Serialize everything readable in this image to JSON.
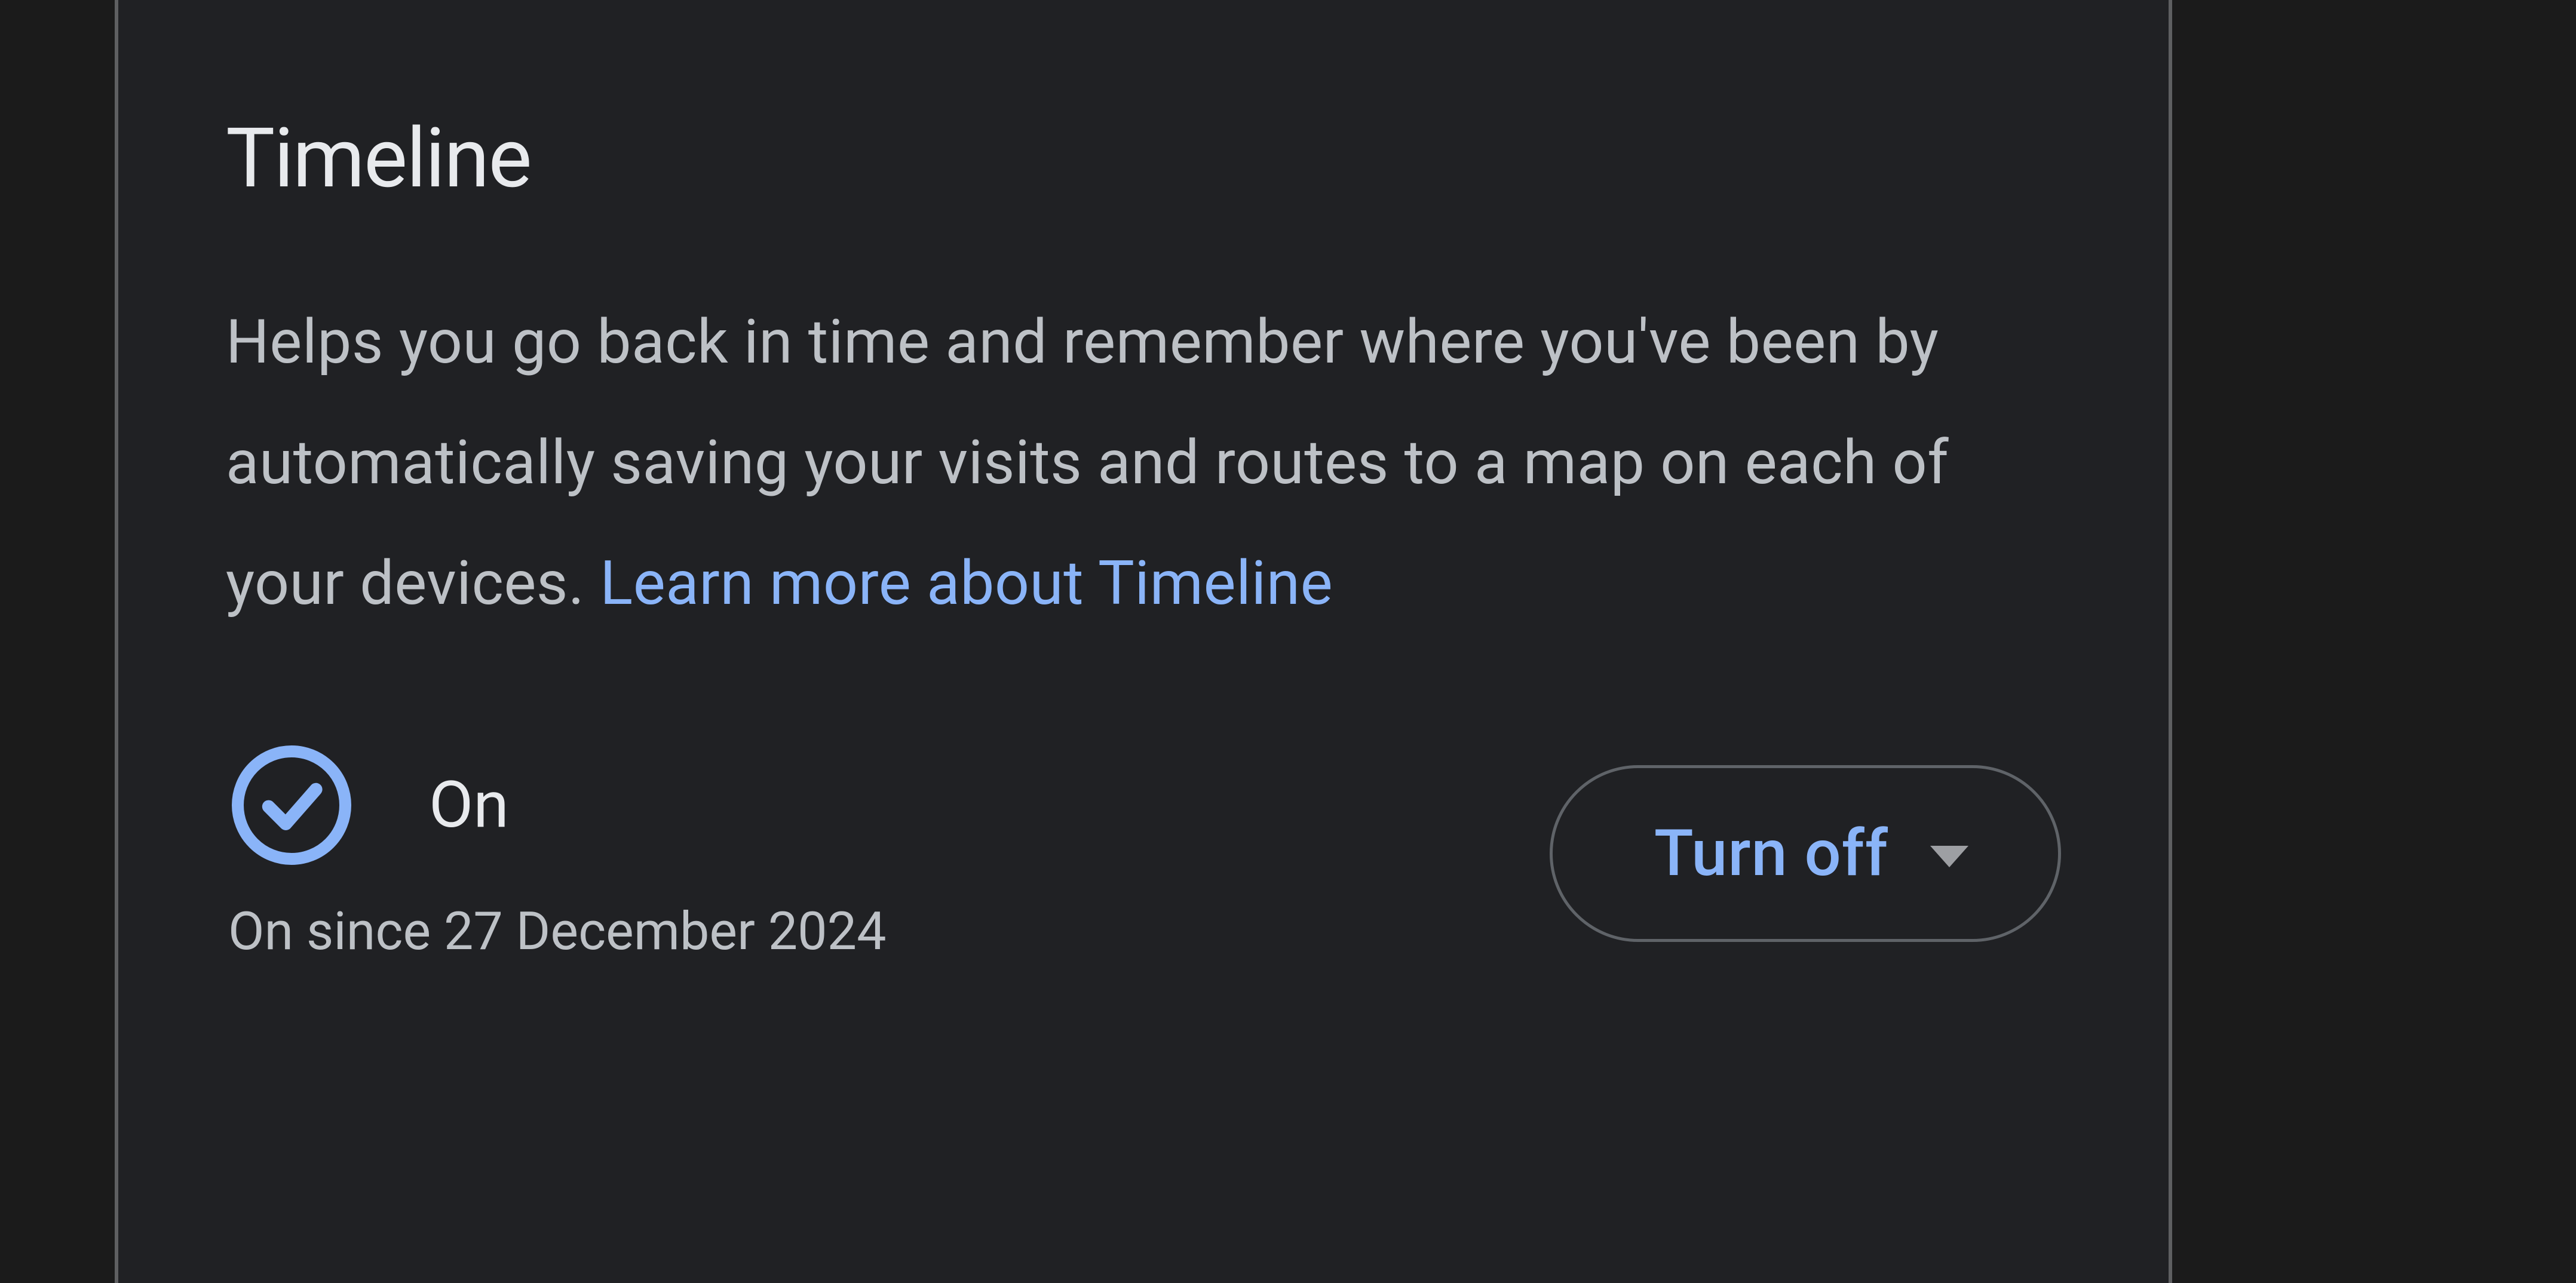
{
  "section": {
    "title": "Timeline",
    "description_text": "Helps you go back in time and remember where you've been by automatically saving your visits and routes to a map on each of your devices. ",
    "learn_more_text": "Learn more about Timeline"
  },
  "status": {
    "label": "On",
    "since_text": "On since 27 December 2024"
  },
  "action": {
    "turn_off_label": "Turn off"
  }
}
